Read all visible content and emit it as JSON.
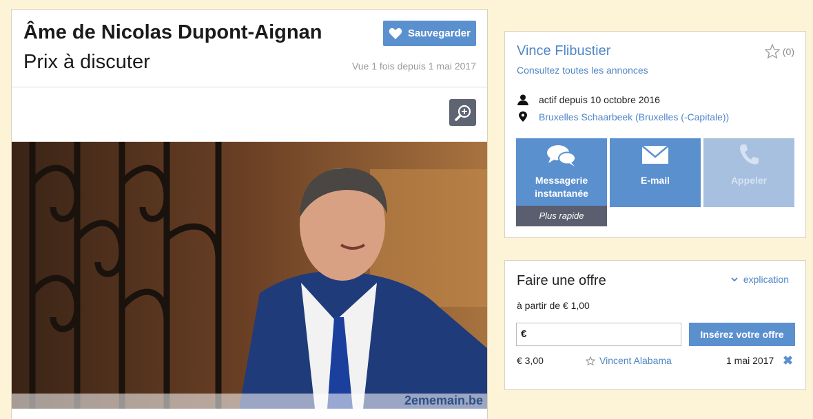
{
  "listing": {
    "title": "Âme de Nicolas Dupont-Aignan",
    "price": "Prix à discuter",
    "save_label": "Sauvegarder",
    "views": "Vue 1 fois depuis 1 mai 2017",
    "watermark": "2ememain.be"
  },
  "seller": {
    "name": "Vince Flibustier",
    "rating": "(0)",
    "all_ads": "Consultez toutes les annonces",
    "active_since": "actif depuis 10 octobre 2016",
    "location": "Bruxelles Schaarbeek (Bruxelles (-Capitale))",
    "contact": {
      "messenger_line1": "Messagerie",
      "messenger_line2": "instantanée",
      "messenger_badge": "Plus rapide",
      "email": "E-mail",
      "call": "Appeler"
    }
  },
  "offer": {
    "title": "Faire une offre",
    "explain": "explication",
    "from": "à partir de € 1,00",
    "input_value": "€",
    "submit": "Insérez votre offre",
    "bids": [
      {
        "amount": "€ 3,00",
        "user": "Vincent Alabama",
        "date": "1 mai 2017"
      }
    ]
  },
  "colors": {
    "accent": "#5b90cf",
    "link": "#4f86c6",
    "background": "#fdf3d6"
  }
}
